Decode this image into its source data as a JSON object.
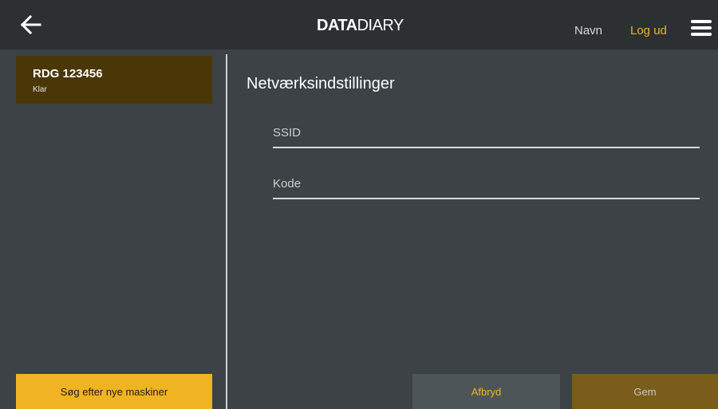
{
  "header": {
    "logo_bold": "DATA",
    "logo_thin": "DIARY",
    "nav_name": "Navn",
    "logout_label": "Log ud",
    "back_icon": "arrow-left-icon",
    "menu_icon": "hamburger-menu-icon"
  },
  "sidebar": {
    "machines": [
      {
        "name": "RDG 123456",
        "status": "Klar"
      }
    ],
    "scan_button_label": "Søg efter nye maskiner"
  },
  "main": {
    "title": "Netværksindstillinger",
    "ssid": {
      "placeholder": "SSID",
      "value": ""
    },
    "code": {
      "placeholder": "Kode",
      "value": ""
    },
    "cancel_label": "Afbryd",
    "save_label": "Gem"
  },
  "colors": {
    "background": "#3c4245",
    "topbar": "#2c3032",
    "accent": "#f0b323",
    "selected_card": "#4a3708",
    "save_button": "#7a5d1a",
    "cancel_button": "#4e5558"
  }
}
